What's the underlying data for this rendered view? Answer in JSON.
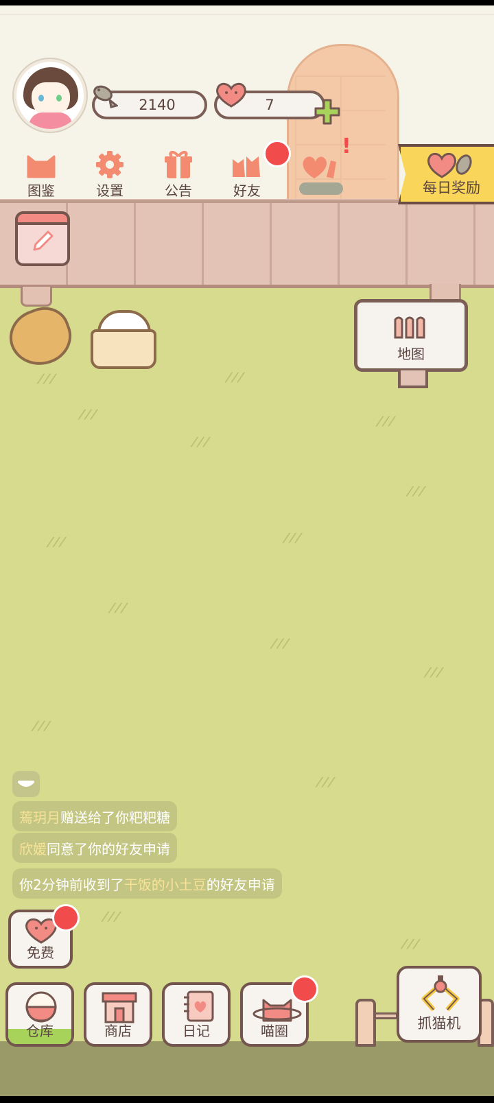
{
  "player": {
    "fish_count": "2140",
    "heart_count": "7"
  },
  "menu": [
    {
      "label": "图鉴",
      "icon": "cat-head-icon"
    },
    {
      "label": "设置",
      "icon": "gear-icon"
    },
    {
      "label": "公告",
      "icon": "gift-icon"
    },
    {
      "label": "好友",
      "icon": "friends-icon"
    },
    {
      "label": "",
      "icon": "heart-hands-icon"
    }
  ],
  "daily_reward": {
    "label": "每日奖励"
  },
  "map": {
    "label": "地图"
  },
  "chat": {
    "line1": {
      "name": "蔫玥月",
      "text": "赠送给了你粑粑糖"
    },
    "line2": {
      "name": "欣媛",
      "text": "同意了你的好友申请"
    },
    "line3": {
      "prefix": "你2分钟前收到了",
      "name": "干饭的小土豆",
      "suffix": "的好友申请"
    }
  },
  "free": {
    "label": "免费"
  },
  "bottom_bar": [
    {
      "label": "仓库",
      "icon": "rice-bowl-icon"
    },
    {
      "label": "商店",
      "icon": "shop-icon"
    },
    {
      "label": "日记",
      "icon": "diary-icon"
    },
    {
      "label": "喵圈",
      "icon": "cat-planet-icon"
    }
  ],
  "claw_machine": {
    "label": "抓猫机"
  },
  "colors": {
    "grass": "#d6db8e",
    "fence": "#e3c3b6",
    "outline": "#74564f",
    "notification": "#f24b4b",
    "reward_flag": "#f9d65a",
    "highlight_name": "#f7e29a"
  }
}
